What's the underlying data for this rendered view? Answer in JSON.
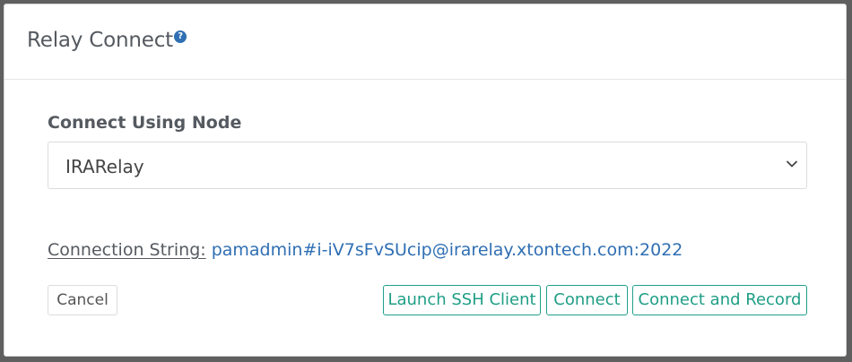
{
  "modal": {
    "title": "Relay Connect",
    "help_icon": "question-circle-icon",
    "help_glyph": "?"
  },
  "node": {
    "label": "Connect Using Node",
    "selected": "IRARelay",
    "dropdown_icon": "chevron-down-icon"
  },
  "connection": {
    "label": "Connection String:",
    "value": "pamadmin#i-iV7sFvSUcip@irarelay.xtontech.com:2022"
  },
  "buttons": {
    "cancel": "Cancel",
    "launch_ssh": "Launch SSH Client",
    "connect": "Connect",
    "connect_record": "Connect and Record"
  },
  "colors": {
    "accent_teal": "#1fa08a",
    "link_blue": "#2f6fb3",
    "overlay": "#5f5f5f"
  }
}
